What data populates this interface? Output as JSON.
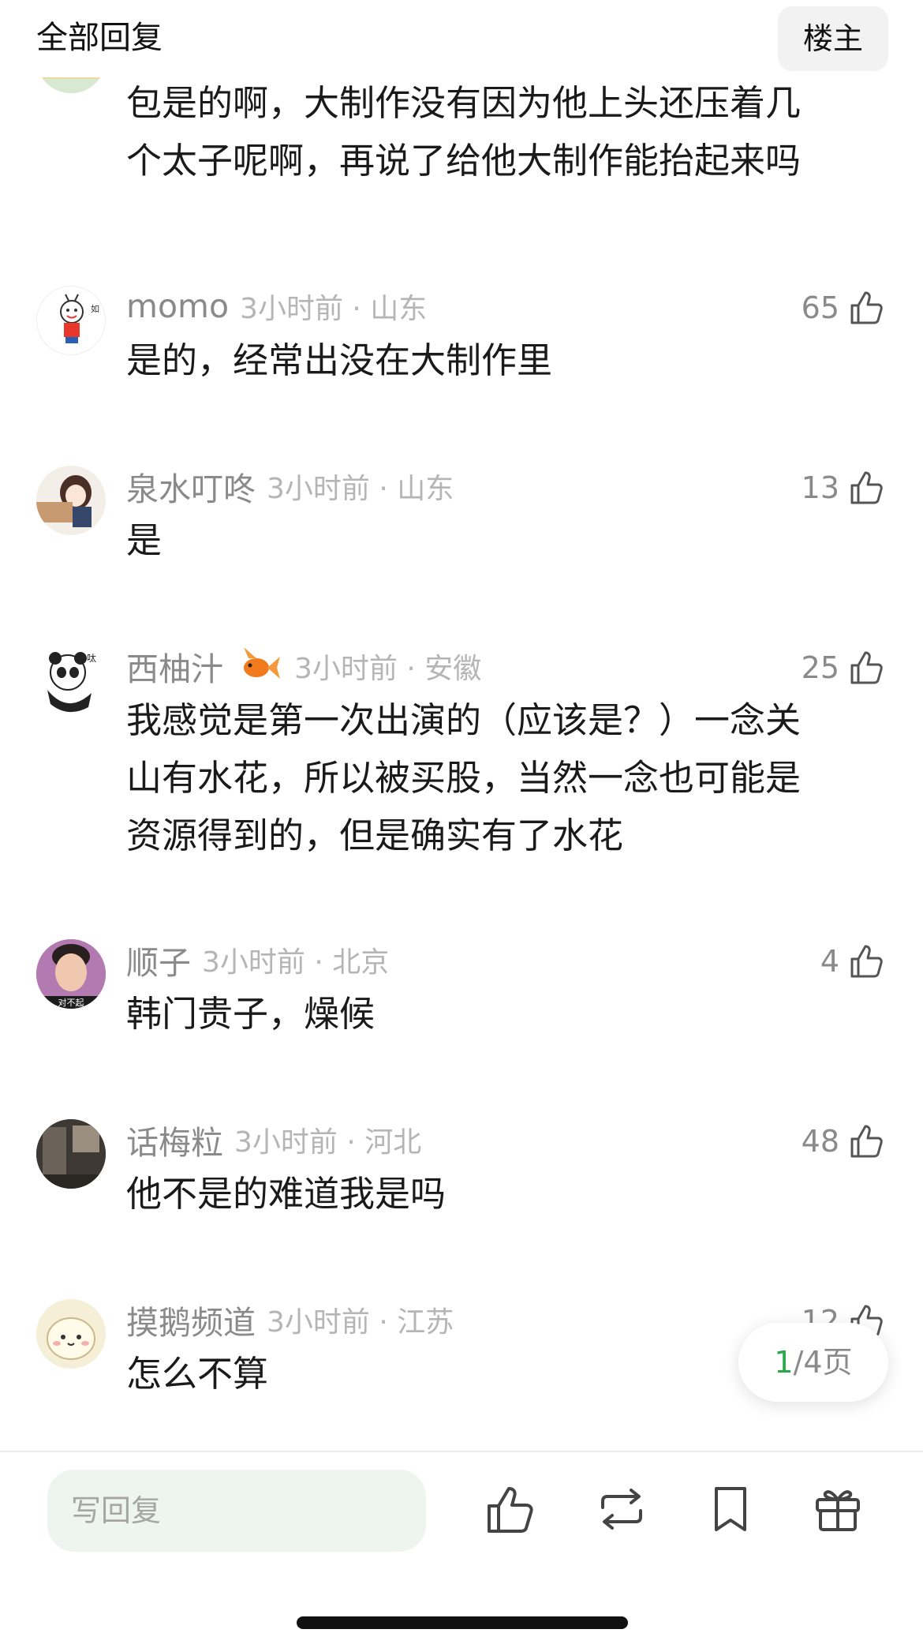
{
  "header": {
    "title": "全部回复",
    "op_button": "楼主"
  },
  "comments": [
    {
      "user": "",
      "time": "",
      "location": "",
      "likes": "",
      "text_lines": [
        "包是的啊，大制作没有因为他上头还压着几",
        "个太子呢啊，再说了给他大制作能抬起来吗"
      ]
    },
    {
      "user": "momo",
      "time": "3小时前",
      "location": "山东",
      "likes": "65",
      "text_lines": [
        "是的，经常出没在大制作里"
      ]
    },
    {
      "user": "泉水叮咚",
      "time": "3小时前",
      "location": "山东",
      "likes": "13",
      "text_lines": [
        "是"
      ]
    },
    {
      "user": "西柚汁",
      "time": "3小时前",
      "location": "安徽",
      "likes": "25",
      "medal_icon": "goldfish-icon",
      "text_lines": [
        "我感觉是第一次出演的（应该是？）一念关",
        "山有水花，所以被买股，当然一念也可能是",
        "资源得到的，但是确实有了水花"
      ]
    },
    {
      "user": "顺子",
      "time": "3小时前",
      "location": "北京",
      "likes": "4",
      "avatar_caption": "对不起",
      "text_lines": [
        "韩门贵子，燥候"
      ]
    },
    {
      "user": "话梅粒",
      "time": "3小时前",
      "location": "河北",
      "likes": "48",
      "text_lines": [
        "他不是的难道我是吗"
      ]
    },
    {
      "user": "摸鹅频道",
      "time": "3小时前",
      "location": "江苏",
      "likes": "12",
      "text_lines": [
        "怎么不算"
      ]
    }
  ],
  "pager": {
    "current": "1",
    "total_label": "/4页"
  },
  "bottom_bar": {
    "reply_placeholder": "写回复",
    "icons": [
      "thumbs-up-icon",
      "repost-icon",
      "bookmark-icon",
      "gift-icon"
    ]
  },
  "colors": {
    "accent": "#2aa84a",
    "muted": "#8a8a8a",
    "light": "#b5b5b5",
    "input_bg": "#eef4ef"
  }
}
